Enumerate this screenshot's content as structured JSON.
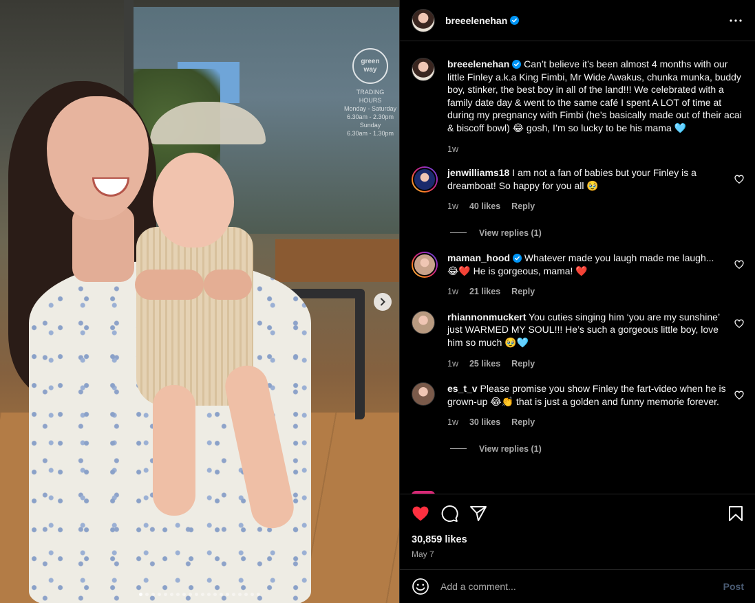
{
  "post": {
    "username": "breeelenehan",
    "verified": true,
    "caption": "Can’t believe it’s been almost 4 months with our little Finley a.k.a King Fimbi, Mr Wide Awakus, chunka munka, buddy boy, stinker, the best boy in all of the land!!! We celebrated with a family date day & went to the same café I spent A LOT of time at during my pregnancy with Fimbi (he’s basically made out of their acai & biscoff bowl) 😂 gosh, I’m so lucky to be his mama 🩵",
    "caption_age": "1w",
    "likes": "30,859 likes",
    "date": "May 7",
    "liked": true,
    "carousel": {
      "total": 20,
      "current": 1
    }
  },
  "photo_sign": {
    "badge": "green way",
    "lines": [
      "TRADING",
      "HOURS",
      "Monday - Saturday",
      "6.30am - 2.30pm",
      "Sunday",
      "6.30am - 1.30pm"
    ]
  },
  "comments": [
    {
      "username": "jenwilliams18",
      "verified": false,
      "text": "I am not a fan of babies but your Finley is a dreamboat! So happy for you all 🥹",
      "age": "1w",
      "likes": "40 likes",
      "reply": "Reply",
      "view_replies": "View replies (1)",
      "ring": true,
      "avatar_color": "#1a2a6c"
    },
    {
      "username": "maman_hood",
      "verified": true,
      "text": "Whatever made you laugh made me laugh... 😂❤️ He is gorgeous, mama! ❤️",
      "age": "1w",
      "likes": "21 likes",
      "reply": "Reply",
      "view_replies": "",
      "ring": true,
      "avatar_color": "#c9a38c"
    },
    {
      "username": "rhiannonmuckert",
      "verified": false,
      "text": "You cuties singing him ‘you are my sunshine’ just WARMED MY SOUL!!! He’s such a gorgeous little boy, love him so much 🥹🩵",
      "age": "1w",
      "likes": "25 likes",
      "reply": "Reply",
      "view_replies": "",
      "ring": false,
      "avatar_color": "#b89a80"
    },
    {
      "username": "es_t_v",
      "verified": false,
      "text": "Please promise you show Finley the fart-video when he is grown-up 😂👏 that is just a golden and funny memorie forever.",
      "age": "1w",
      "likes": "30 likes",
      "reply": "Reply",
      "view_replies": "View replies (1)",
      "ring": false,
      "avatar_color": "#7a5a4a"
    }
  ],
  "add_comment": {
    "placeholder": "Add a comment...",
    "post_label": "Post"
  },
  "icons": {
    "more": "more-horizontal-icon",
    "like": "heart-icon",
    "comment": "comment-icon",
    "share": "send-icon",
    "save": "bookmark-icon",
    "emoji": "emoji-icon",
    "next": "chevron-right-icon",
    "verified": "verified-badge-icon"
  },
  "colors": {
    "background": "#000000",
    "text": "#f5f5f5",
    "muted": "#a8a8a8",
    "like_red": "#ff3040",
    "verified_blue": "#0095f6",
    "post_disabled": "#4a5b73",
    "divider": "#262626"
  }
}
